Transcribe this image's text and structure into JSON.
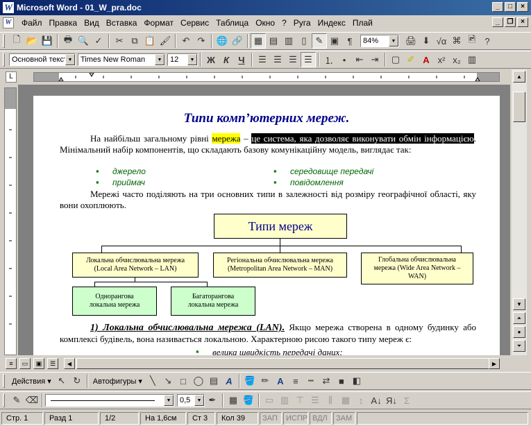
{
  "window": {
    "title": "Microsoft Word - 01_W_pra.doc",
    "app_icon": "W"
  },
  "menu": [
    "Файл",
    "Правка",
    "Вид",
    "Вставка",
    "Формат",
    "Сервис",
    "Таблица",
    "Окно",
    "?",
    "Руга",
    "Индекс",
    "Плай"
  ],
  "standard_toolbar": {
    "zoom": "84%"
  },
  "formatting_toolbar": {
    "style": "Основной текст",
    "font": "Times New Roman",
    "size": "12",
    "bold": "Ж",
    "italic": "К",
    "underline": "Ч"
  },
  "document": {
    "title": "Типи комп’ютерних мереж.",
    "p1_a": "На найбільш загальному рівні ",
    "p1_hl": "мережа",
    "p1_b": " – ",
    "p1_sel": "це система, яка дозволяє виконувати обмін інформацією",
    "p1_c": ". Мінімальний набір компонентів, що складають базову комунікаційну модель, виглядає так:",
    "bullets": [
      "джерело",
      "приймач",
      "середовище передачі",
      "повідомлення"
    ],
    "p2": "Мережі часто поділяють на три основних типи в залежності від розміру географічної області, яку вони охоплюють.",
    "diagram": {
      "root": "Типи мереж",
      "lan": "Локальна обчислювальна мережа (Local Area Network – LAN)",
      "man": "Регіональна обчислювальна мережа (Metropolitan Area Network – MAN)",
      "wan": "Глобальна обчислювальна мережа (Wide Area Network – WAN)",
      "single": "Однорангова локальна мережа",
      "multi": "Багаторангова локальна мережа"
    },
    "sec1_head": "1) Локальна обчислювальна мережа (LAN).",
    "sec1_text": " Якщо мережа створена в одному будинку або комплексі будівель, вона називається локальною. Характерною рисою такого типу мереж є:",
    "sec1_bullet": "велика швидкість передачі даних;"
  },
  "drawing_toolbar": {
    "actions": "Действия",
    "autoshapes": "Автофигуры"
  },
  "line_toolbar": {
    "weight": "0,5"
  },
  "status": {
    "page": "Стр. 1",
    "section": "Разд 1",
    "pages": "1/2",
    "at": "На 1,6см",
    "line": "Ст 3",
    "col": "Кол 39",
    "rec": "ЗАП",
    "trk": "ИСПР",
    "ext": "ВДЛ",
    "ovr": "ЗАМ"
  }
}
